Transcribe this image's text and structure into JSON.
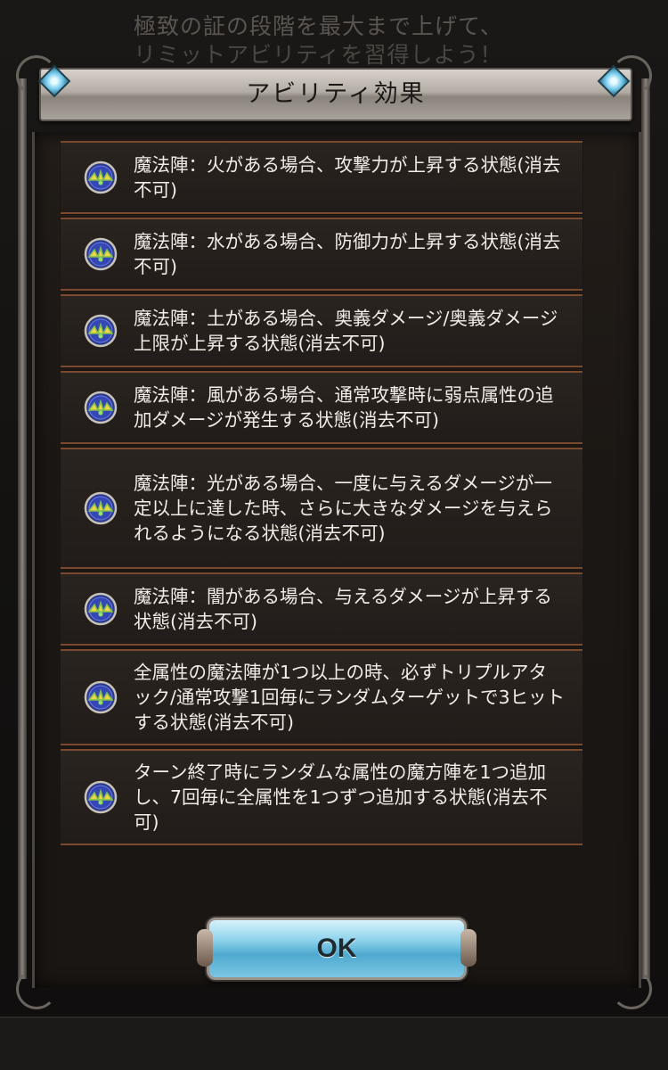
{
  "background": {
    "line1": "極致の証の段階を最大まで上げて、",
    "line2": "リミットアビリティを習得しよう！"
  },
  "dialog": {
    "title": "アビリティ効果",
    "ok_label": "OK"
  },
  "effects": [
    {
      "text": "魔法陣：火がある場合、攻撃力が上昇する状態(消去不可)",
      "icon": "magic-circle-icon"
    },
    {
      "text": "魔法陣：水がある場合、防御力が上昇する状態(消去不可)",
      "icon": "magic-circle-icon"
    },
    {
      "text": "魔法陣：土がある場合、奥義ダメージ/奥義ダメージ上限が上昇する状態(消去不可)",
      "icon": "magic-circle-icon"
    },
    {
      "text": "魔法陣：風がある場合、通常攻撃時に弱点属性の追加ダメージが発生する状態(消去不可)",
      "icon": "magic-circle-icon"
    },
    {
      "text": "魔法陣：光がある場合、一度に与えるダメージが一定以上に達した時、さらに大きなダメージを与えられるようになる状態(消去不可)",
      "icon": "magic-circle-icon"
    },
    {
      "text": "魔法陣：闇がある場合、与えるダメージが上昇する状態(消去不可)",
      "icon": "magic-circle-icon"
    },
    {
      "text": "全属性の魔法陣が1つ以上の時、必ずトリプルアタック/通常攻撃1回毎にランダムターゲットで3ヒットする状態(消去不可)",
      "icon": "magic-circle-icon"
    },
    {
      "text": "ターン終了時にランダムな属性の魔方陣を1つ追加し、7回毎に全属性を1つずつ追加する状態(消去不可)",
      "icon": "magic-circle-icon"
    }
  ]
}
